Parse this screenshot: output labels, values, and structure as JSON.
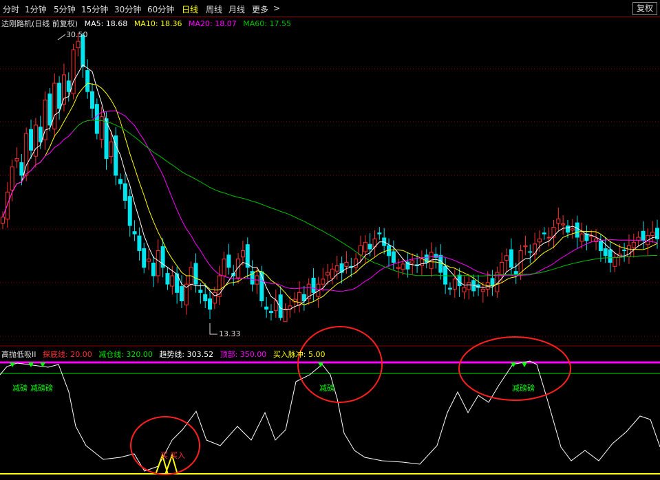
{
  "toolbar": {
    "periods": [
      "分时",
      "1分钟",
      "5分钟",
      "15分钟",
      "30分钟",
      "60分钟",
      "日线",
      "周线",
      "月线",
      "更多"
    ],
    "active": "日线",
    "more_arrow": ">",
    "fq_button": "复权"
  },
  "main_legend": {
    "title": "达刚路机(日线 前复权)",
    "ma5": "MA5: 18.68",
    "ma10": "MA10: 18.36",
    "ma20": "MA20: 18.07",
    "ma60": "MA60: 17.55"
  },
  "colors": {
    "ma5": "#ffffff",
    "ma10": "#ffff00",
    "ma20": "#ff00ff",
    "ma60": "#00c000",
    "up": "#ff3030",
    "down": "#00e5ee",
    "grid": "#8a0000"
  },
  "price_marks": {
    "high": "30.50",
    "low": "13.33"
  },
  "indicator_legend": {
    "name": "高抛低吸II",
    "tandi": "探底线: 20.00",
    "jiancang": "减仓线: 320.00",
    "qushi": "趋势线: 303.52",
    "top": "顶部: 350.00",
    "buy": "买入脉冲: 5.00"
  },
  "signals": {
    "reduce": "减磅",
    "reduce2": "减磅磅",
    "buy_a": "买",
    "buy_b": "买入"
  },
  "chart_data": {
    "type": "candlestick",
    "title": "达刚路机(日线 前复权)",
    "marked_high": 30.5,
    "marked_low": 13.33,
    "ma_latest": {
      "MA5": 18.68,
      "MA10": 18.36,
      "MA20": 18.07,
      "MA60": 17.55
    },
    "close_approx": [
      19.5,
      21,
      22.5,
      23,
      22,
      24.5,
      23.5,
      25,
      24,
      26.5,
      25,
      27.5,
      26,
      28,
      27,
      29.5,
      30,
      28.5,
      27,
      26,
      24.5,
      25.5,
      23,
      24,
      22,
      21.5,
      20.5,
      19,
      18.5,
      17.5,
      16.5,
      17,
      16,
      17.5,
      16.5,
      15.5,
      16,
      15,
      14.5,
      15.5,
      16.5,
      15.5,
      15,
      14.5,
      14,
      15,
      16,
      17,
      16.5,
      16,
      17,
      17.5,
      16.5,
      15.5,
      16,
      14.5,
      14,
      13.8,
      14.5,
      13.5,
      14,
      14.2,
      14.6,
      15,
      14.5,
      15.5,
      15,
      15.5,
      15.8,
      16.2,
      16.4,
      16.6,
      16.2,
      16.8,
      16.5,
      17,
      17.8,
      18,
      17.6,
      18.2,
      18.5,
      17.8,
      17.2,
      16.8,
      16.5,
      16.7,
      16.4,
      16.9,
      16.6,
      17,
      16.8,
      17.4,
      17.1,
      16.2,
      15.5,
      15.2,
      15.8,
      15.4,
      15.3,
      15.6,
      15.1,
      15.3,
      15.2,
      15.6,
      15.4,
      16.2,
      16.8,
      17.2,
      16.5,
      16.1,
      17.5,
      17.8,
      17.4,
      17.9,
      18.2,
      18.5,
      18.3,
      18.9,
      19.4,
      19.1,
      18.6,
      18.8,
      18.3,
      18.5,
      18.1,
      18.4,
      18.2,
      17.5,
      17.2,
      16.8,
      17.1,
      17.3,
      17.5,
      17.8,
      18,
      18.3,
      18.1,
      18.4,
      18.6,
      18.2
    ],
    "indicator": {
      "name": "高抛低吸II",
      "lines": {
        "探底线": 20.0,
        "减仓线": 320.0,
        "趋势线": 303.52,
        "顶部": 350.0,
        "买入脉冲": 5.0
      }
    }
  }
}
